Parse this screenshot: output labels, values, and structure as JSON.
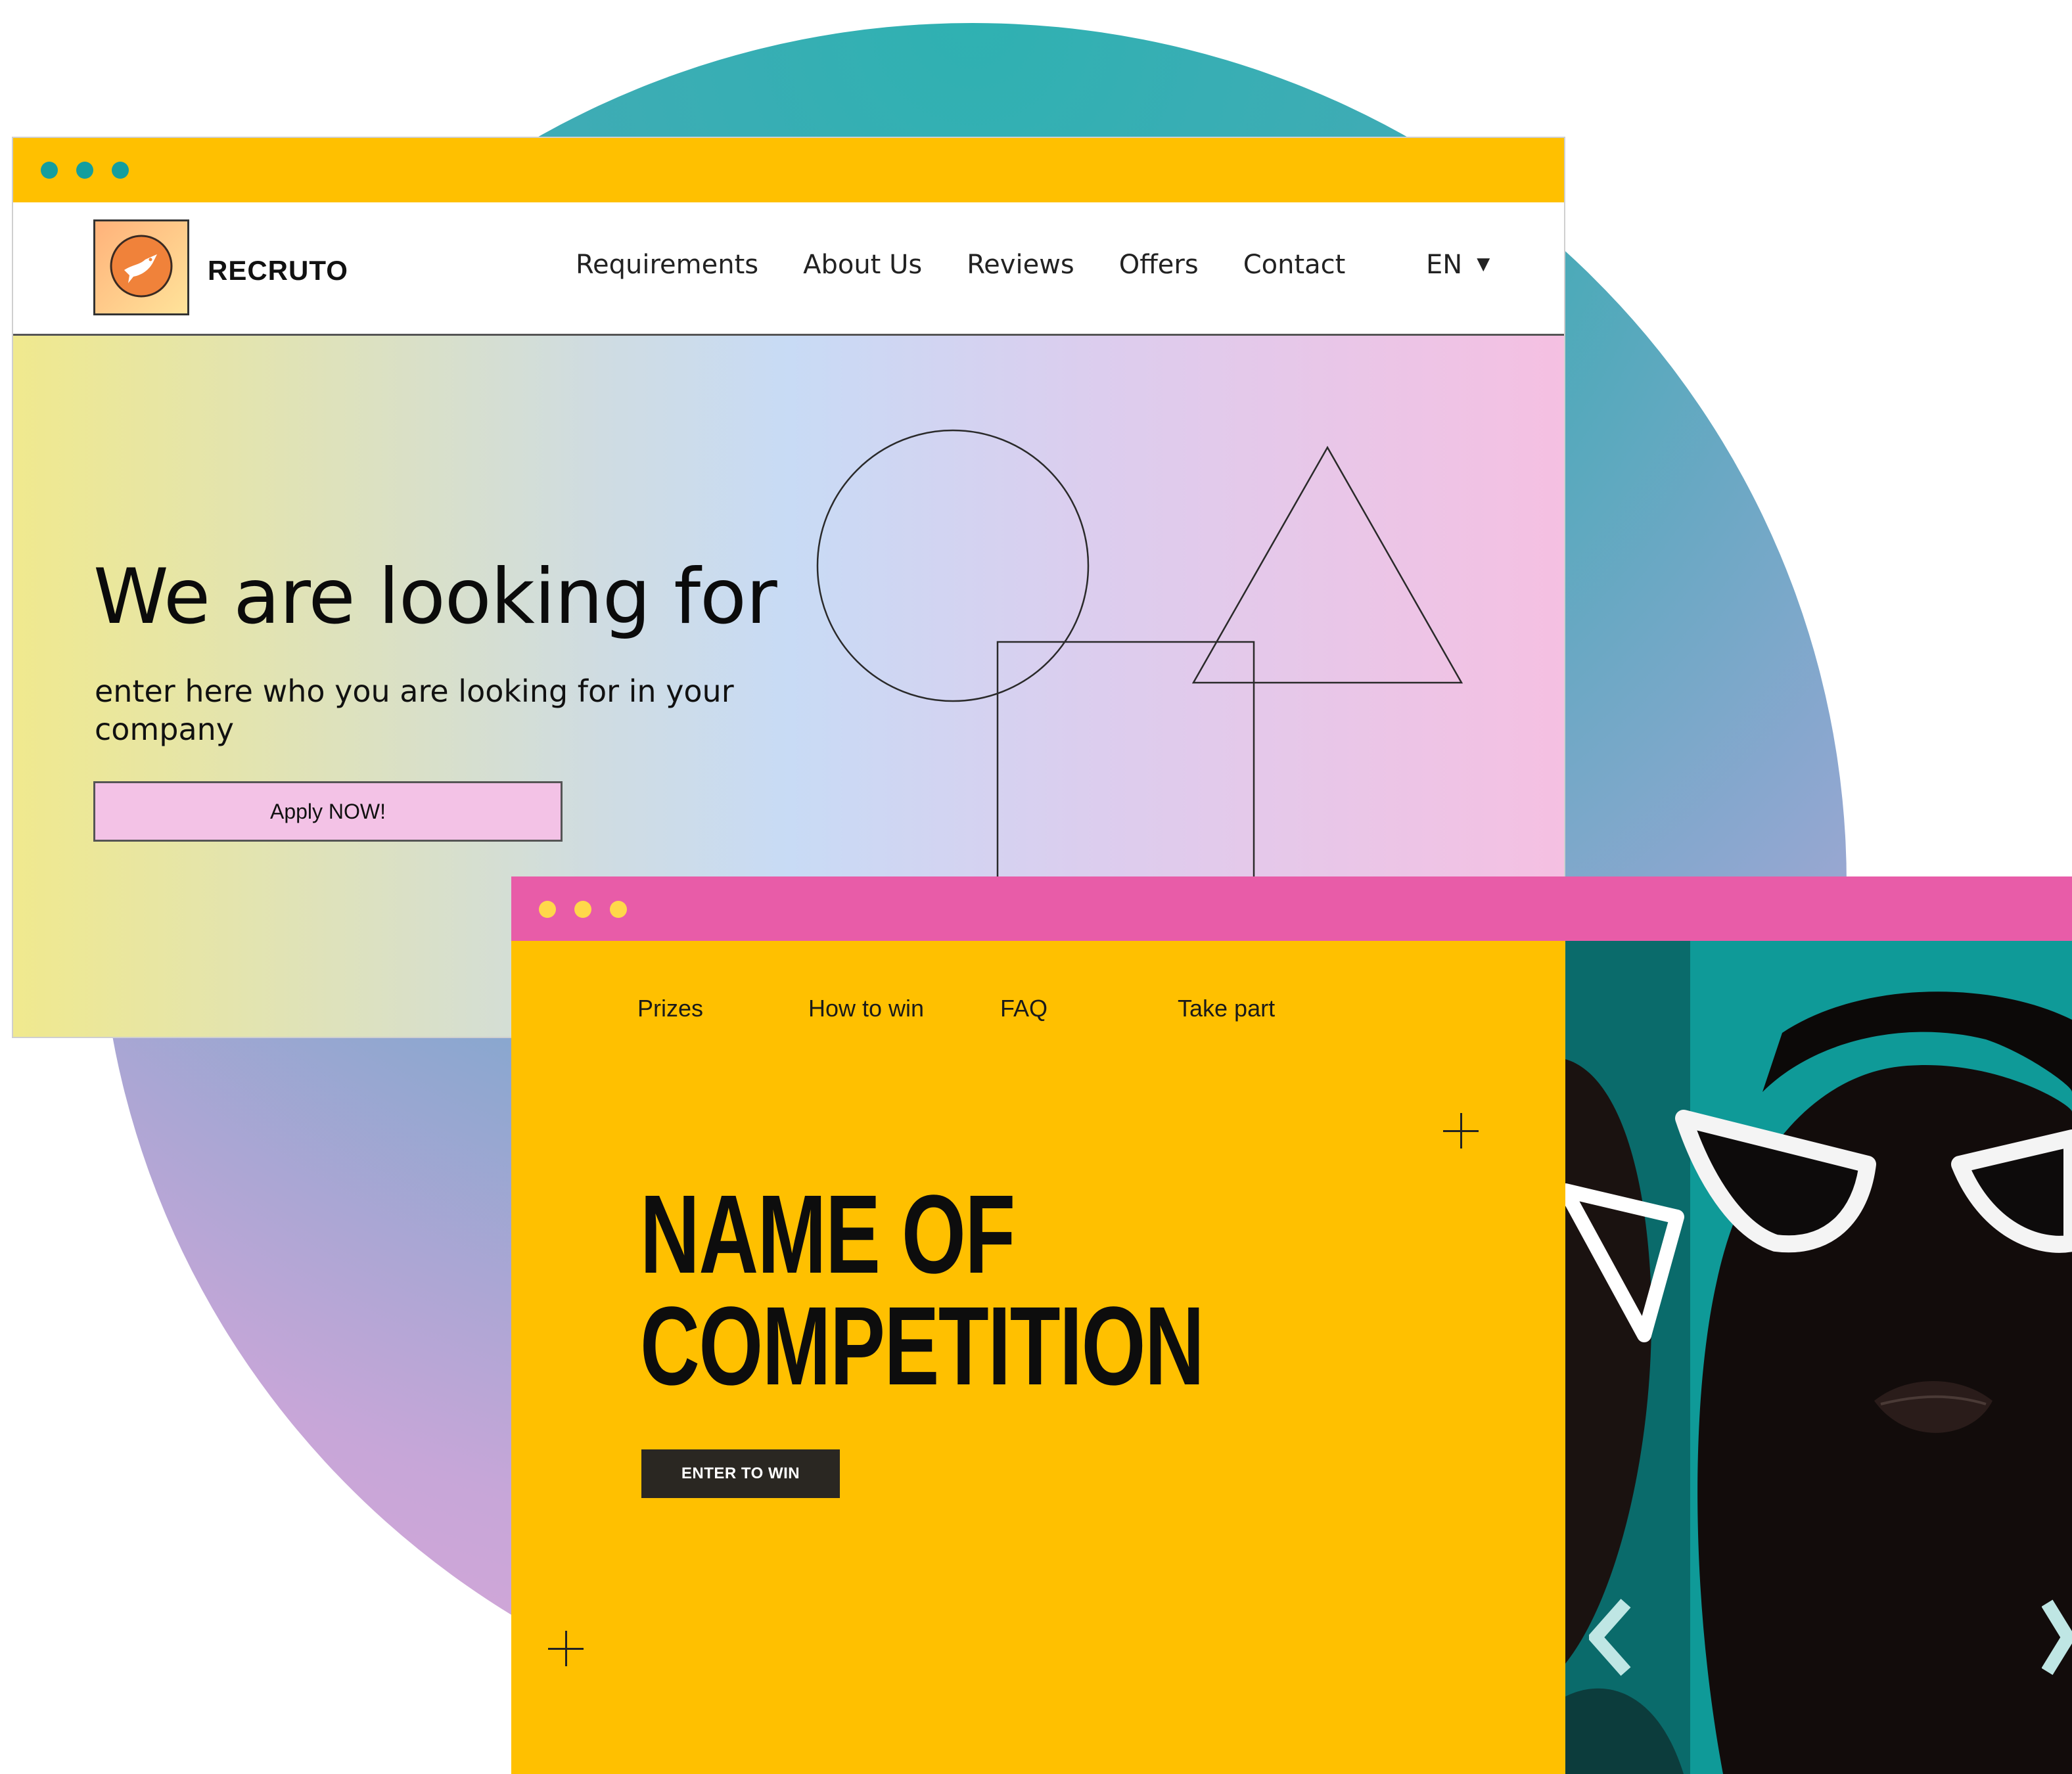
{
  "recruto": {
    "brand": "RECRUTO",
    "nav": [
      "Requirements",
      "About Us",
      "Reviews",
      "Offers",
      "Contact"
    ],
    "language": "EN",
    "hero_title": "We are looking for",
    "hero_subtitle": "enter here who you are looking for in your company",
    "cta": "Apply NOW!"
  },
  "competition": {
    "nav": [
      "Prizes",
      "How to win",
      "FAQ",
      "Take part"
    ],
    "title_line1": "NAME OF",
    "title_line2": "COMPETITION",
    "cta": "ENTER TO WIN"
  },
  "icons": {
    "window_dots": "traffic-light-dots",
    "logo": "bird-icon",
    "dropdown": "caret-down-icon",
    "plus": "plus-icon",
    "carousel_prev": "chevron-left-icon",
    "carousel_next": "chevron-right-icon"
  },
  "colors": {
    "accent_yellow": "#ffc000",
    "accent_pink": "#e85ca8",
    "teal": "#149e9e",
    "button_pink": "#f3c2e6",
    "button_dark": "#2a2722"
  }
}
